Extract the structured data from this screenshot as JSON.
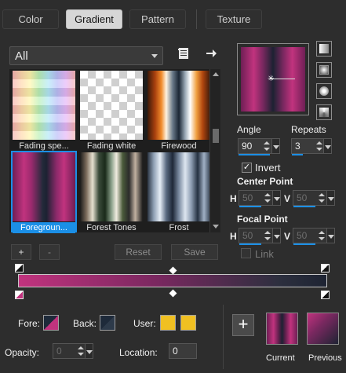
{
  "tabs": [
    {
      "label": "Color",
      "active": false
    },
    {
      "label": "Gradient",
      "active": true
    },
    {
      "label": "Pattern",
      "active": false
    },
    {
      "label": "Texture",
      "active": false
    }
  ],
  "dropdown": {
    "value": "All"
  },
  "gallery": {
    "items": [
      {
        "label": "Fading spe...",
        "selected": false
      },
      {
        "label": "Fading white",
        "selected": false
      },
      {
        "label": "Firewood",
        "selected": false
      },
      {
        "label": "Foregroun...",
        "selected": true
      },
      {
        "label": "Forest Tones",
        "selected": false
      },
      {
        "label": "Frost",
        "selected": false
      }
    ]
  },
  "buttons": {
    "add": "+",
    "remove": "-",
    "reset": "Reset",
    "save": "Save"
  },
  "settings": {
    "angle_label": "Angle",
    "angle_value": "90",
    "repeats_label": "Repeats",
    "repeats_value": "3",
    "invert_label": "Invert",
    "invert_checked": true,
    "center_label": "Center Point",
    "center_h": "50",
    "center_v": "50",
    "focal_label": "Focal Point",
    "focal_h": "50",
    "focal_v": "50",
    "link_label": "Link",
    "link_checked": false,
    "h_label": "H",
    "v_label": "V"
  },
  "bottom": {
    "fore_label": "Fore:",
    "back_label": "Back:",
    "user_label": "User:",
    "opacity_label": "Opacity:",
    "opacity_value": "0",
    "location_label": "Location:",
    "location_value": "0",
    "current_label": "Current",
    "previous_label": "Previous"
  },
  "colors": {
    "accent": "#1b8fe6",
    "fore": "#c1337e",
    "back": "#1e2a3a",
    "user": "#f0c022"
  }
}
